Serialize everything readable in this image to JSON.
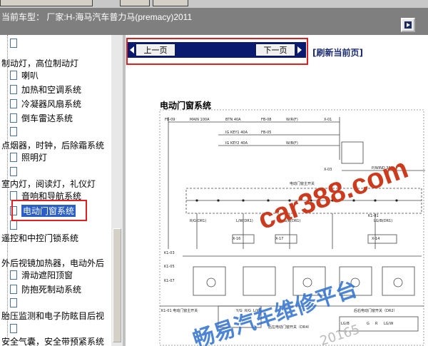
{
  "header": {
    "car_model": "当前车型： 厂家:H-海马汽车普力马(premacy)2011"
  },
  "sidebar": {
    "items": [
      {
        "label": ""
      },
      {
        "label": "制动灯，高位制动灯"
      },
      {
        "label": "喇叭"
      },
      {
        "label": "加热和空调系统"
      },
      {
        "label": "冷凝器风扇系统"
      },
      {
        "label": "倒车雷达系统"
      },
      {
        "label": ""
      },
      {
        "label": "点烟器，时钟，后除霜系统"
      },
      {
        "label": "照明灯"
      },
      {
        "label": ""
      },
      {
        "label": "室内灯，阅读灯，礼仪灯"
      },
      {
        "label": "音响和导航系统"
      },
      {
        "label": "电动门窗系统"
      },
      {
        "label": ""
      },
      {
        "label": "遥控和中控门锁系统"
      },
      {
        "label": "外后视镜加热器，电动外后"
      },
      {
        "label": "滑动遮阳顶窗"
      },
      {
        "label": "防抱死制动系统"
      },
      {
        "label": ""
      },
      {
        "label": "胎压监测和电子防眩目后视"
      },
      {
        "label": ""
      },
      {
        "label": "安全气囊，安全带预紧系统"
      }
    ]
  },
  "nav": {
    "prev": "上一页",
    "next": "下一页",
    "refresh": "[刷新当前页]"
  },
  "diagram": {
    "title": "电动门窗系统",
    "labels": {
      "main_fuse": "MAIN 100A",
      "btn_fuse": "BTN 40A",
      "fb09": "FB-09",
      "fb08": "FB-08",
      "fb05": "FB-05",
      "ig_key1": "IG KEY1 40A",
      "ig_key2": "IG KEY2 40A",
      "wr": "W/R(F)",
      "wb": "W/B(F)",
      "x01": "X-01",
      "x03": "X-03",
      "pwnd": "P/WIND 30A",
      "k101": "K1-01",
      "k103": "K1-03",
      "k105": "K1-05",
      "k107": "K1-07",
      "x14": "X-14",
      "x15": "X-15",
      "x16": "X-16",
      "x17": "X-17",
      "rgr1": "R/G(DR1)",
      "lwr1": "L/W(DR1)",
      "gr1": "G/R(DR1)",
      "lgb1": "LG/B(DR1)",
      "dr2": "后右电动门窗开关（DR2）",
      "dr4": "后左电动门窗开关（DR4）",
      "k101b": "K1-01  电动门窗主开关",
      "bus": "电动门窗主开关",
      "yg": "Y/G",
      "rg": "R/G",
      "lg": "L/W",
      "lgb": "LG/B",
      "g": "G",
      "r": "R",
      "lgw": "LG/W"
    }
  },
  "watermarks": {
    "site": "car388.com",
    "platform": "畅易汽车维修平台",
    "fragment": "20165"
  },
  "colors": {
    "selection": "#2b5fc4",
    "highlight_box": "#e02020",
    "nav_bg": "#0a1a6e",
    "watermark_red": "#cc3b1e",
    "watermark_blue": "#2d6fd0"
  }
}
